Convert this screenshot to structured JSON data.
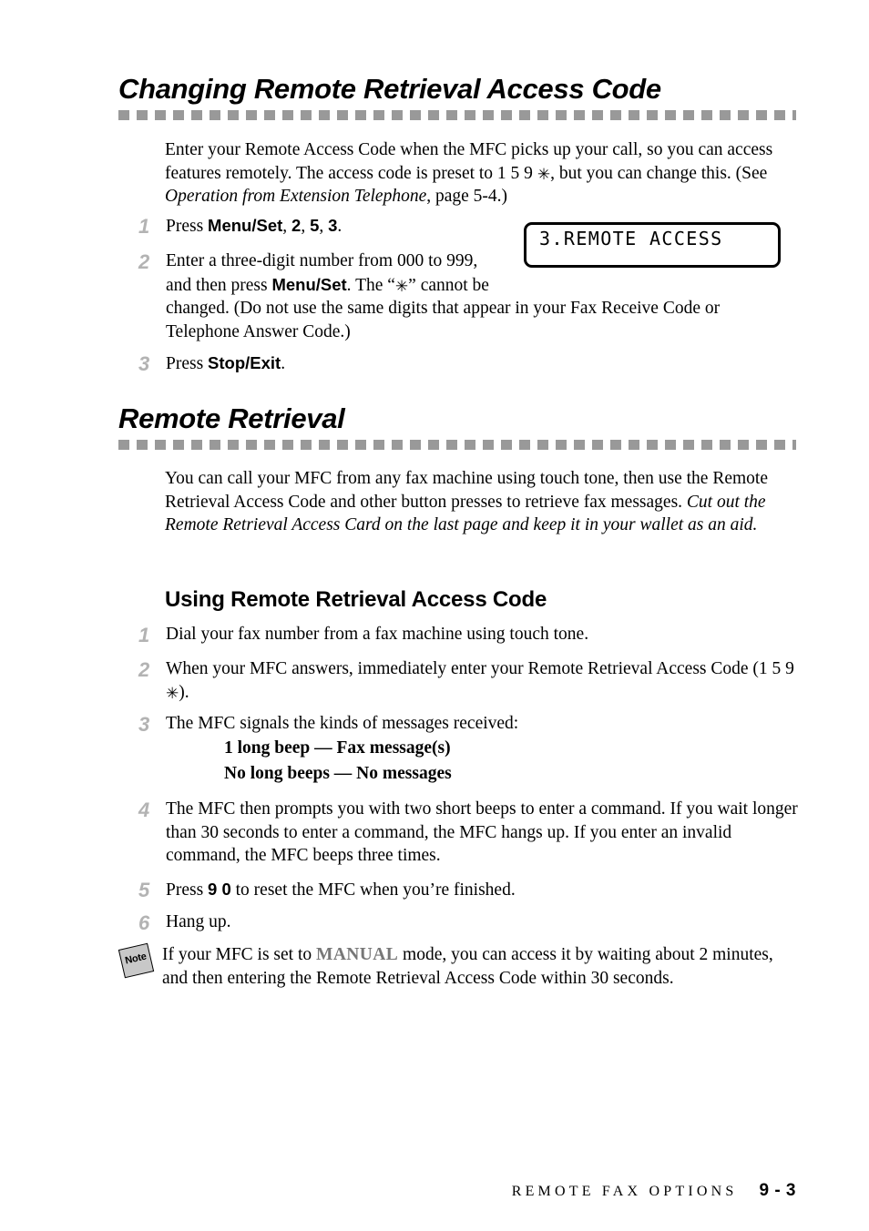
{
  "sections": {
    "changing": {
      "heading": "Changing Remote Retrieval Access Code",
      "intro_part1": "Enter your Remote Access Code when the MFC picks up your call, so you can access features remotely.  The access code is preset to 1 5 9 ",
      "intro_star": "✳",
      "intro_part2": ", but you can change this. (See ",
      "intro_italic": "Operation from Extension Telephone",
      "intro_part3": ", page 5-4.)",
      "steps": [
        {
          "number": "1",
          "text_part1": "Press ",
          "bold1": "Menu/Set",
          "text_part2": ", ",
          "bold2": "2",
          "text_part3": ", ",
          "bold3": "5",
          "text_part4": ", ",
          "bold4": "3",
          "text_part5": "."
        },
        {
          "number": "2",
          "text_part1": "Enter a three-digit number from 000 to 999, and then press ",
          "bold1": "Menu/Set",
          "text_part2": ". The “",
          "star": "✳",
          "text_part3": "” cannot be changed. (Do not use the same digits that appear in your Fax Receive Code or Telephone Answer Code.)"
        },
        {
          "number": "3",
          "text_part1": "Press ",
          "bold1": "Stop/Exit",
          "text_part2": "."
        }
      ],
      "lcd_display": "3.REMOTE ACCESS"
    },
    "remote_retrieval": {
      "heading": "Remote Retrieval",
      "intro_part1": "You can call your MFC from any fax machine using touch tone, then use the Remote Retrieval Access Code and other button presses to retrieve fax messages. ",
      "intro_italic": "Cut out the Remote Retrieval Access Card on the last page and keep it in your wallet as an aid.",
      "subheading": "Using Remote Retrieval Access Code",
      "steps": [
        {
          "number": "1",
          "text_part1": "Dial your fax number from a fax machine using touch tone."
        },
        {
          "number": "2",
          "text_part1": "When your MFC answers, immediately enter your Remote Retrieval Access Code (1 5 9 ",
          "star": "✳",
          "text_part2": ")."
        },
        {
          "number": "3",
          "text_part1": "The MFC signals the kinds of messages received:",
          "beep_line1": "1 long beep — Fax message(s)",
          "beep_line2": "No long beeps — No messages"
        },
        {
          "number": "4",
          "text_part1": "The MFC then prompts you with two short beeps to enter a command.  If you wait longer than 30 seconds to enter a command, the MFC hangs up.  If you enter an invalid command, the MFC beeps three times."
        },
        {
          "number": "5",
          "text_part1": "Press ",
          "bold1": "9 0",
          "text_part2": " to reset the MFC when you’re finished."
        },
        {
          "number": "6",
          "text_part1": "Hang up."
        }
      ],
      "note": {
        "icon_label": "Note",
        "text_part1": "If your MFC is set to ",
        "highlight": "MANUAL",
        "text_part2": " mode, you can access it by waiting about 2 minutes, and then entering the Remote Retrieval Access Code within 30 seconds."
      }
    }
  },
  "footer": {
    "title": "REMOTE FAX OPTIONS",
    "page": "9 - 3"
  },
  "colors": {
    "rule_gray": "#999999",
    "step_number_gray": "#b3b3b3",
    "note_icon_gray": "#c8c8c8",
    "manual_gray": "#777777"
  }
}
